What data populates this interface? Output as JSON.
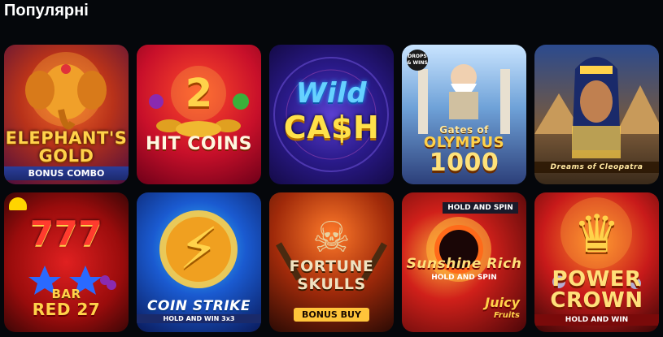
{
  "section": {
    "title": "Популярні"
  },
  "games": [
    {
      "title_lines": [
        "ELEPHANT'S",
        "GOLD"
      ],
      "subtitle": "BONUS COMBO"
    },
    {
      "number": "2",
      "title": "HIT COINS"
    },
    {
      "title_lines": [
        "Wild",
        "CA$H"
      ]
    },
    {
      "badge": "DROPS & WINS",
      "title_lines": [
        "Gates of",
        "OLYMPUS",
        "1000"
      ]
    },
    {
      "title": "Dreams of Cleopatra"
    },
    {
      "title_lines": [
        "777",
        "BAR",
        "RED 27"
      ]
    },
    {
      "title": "COIN STRIKE",
      "subtitle": "HOLD AND WIN 3x3"
    },
    {
      "title_lines": [
        "FORTUNE",
        "SKULLS"
      ],
      "subtitle": "BONUS BUY"
    },
    {
      "ribbon": "HOLD AND SPIN",
      "title": "Sunshine Rich",
      "subtitle": "HOLD AND SPIN",
      "brand_lines": [
        "Juicy",
        "Fruits"
      ]
    },
    {
      "title_lines": [
        "POWER",
        "CROWN"
      ],
      "subtitle": "HOLD AND WIN"
    }
  ]
}
